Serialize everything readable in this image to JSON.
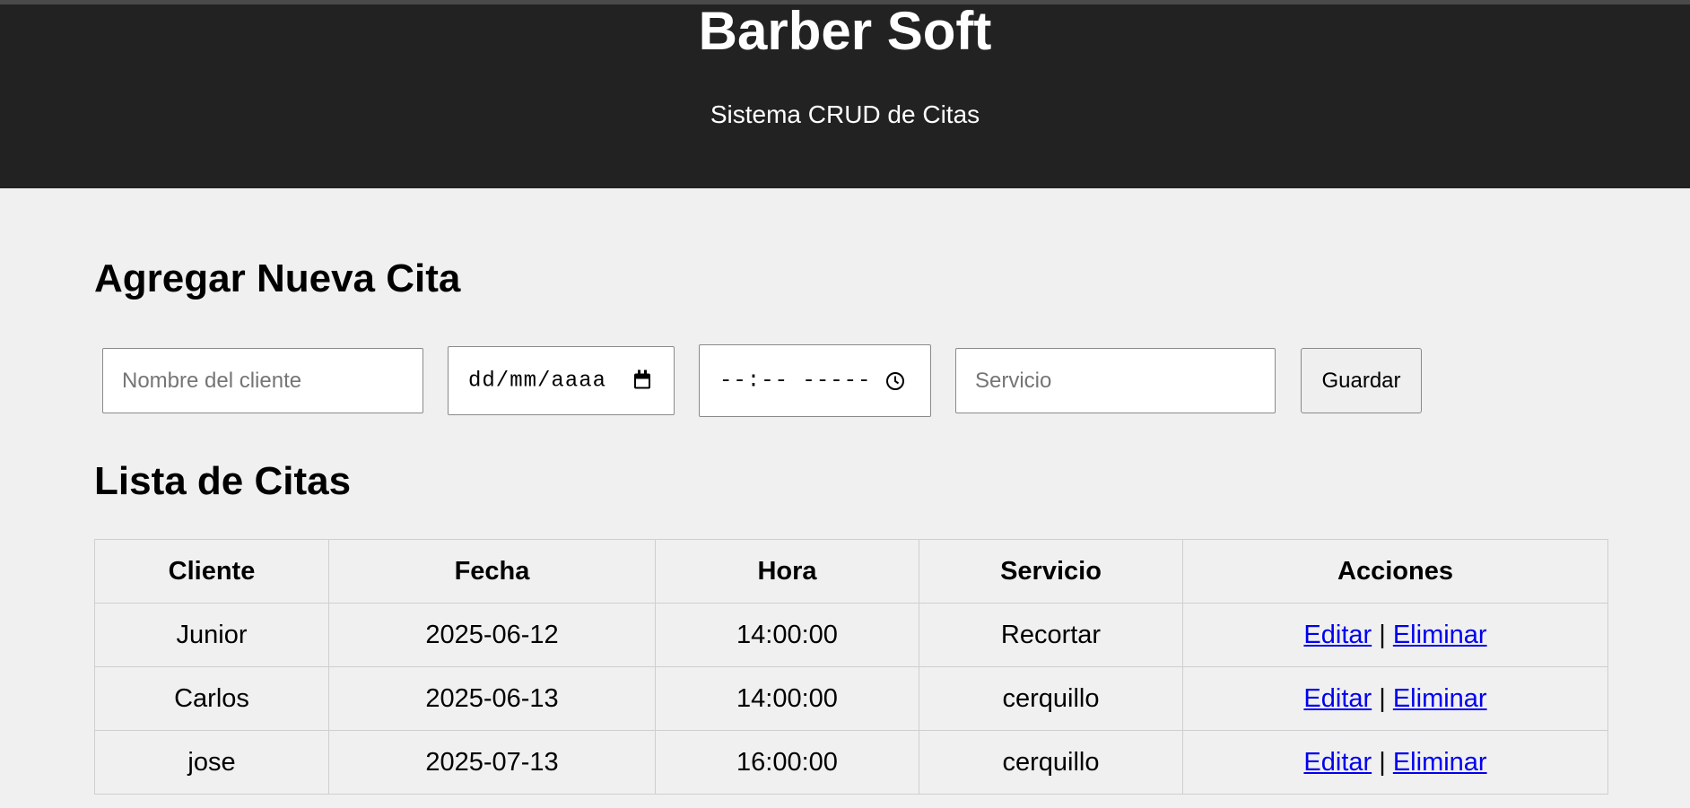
{
  "header": {
    "title": "Barber Soft",
    "subtitle": "Sistema CRUD de Citas"
  },
  "form": {
    "title": "Agregar Nueva Cita",
    "client_placeholder": "Nombre del cliente",
    "date_placeholder": "dd/mm/aaaa",
    "time_placeholder": "--:-- -----",
    "service_placeholder": "Servicio",
    "save_label": "Guardar"
  },
  "list": {
    "title": "Lista de Citas",
    "columns": [
      "Cliente",
      "Fecha",
      "Hora",
      "Servicio",
      "Acciones"
    ],
    "rows": [
      {
        "cliente": "Junior",
        "fecha": "2025-06-12",
        "hora": "14:00:00",
        "servicio": "Recortar",
        "edit": "Editar",
        "sep": "|",
        "delete": "Eliminar"
      },
      {
        "cliente": "Carlos",
        "fecha": "2025-06-13",
        "hora": "14:00:00",
        "servicio": "cerquillo",
        "edit": "Editar",
        "sep": "|",
        "delete": "Eliminar"
      },
      {
        "cliente": "jose",
        "fecha": "2025-07-13",
        "hora": "16:00:00",
        "servicio": "cerquillo",
        "edit": "Editar",
        "sep": "|",
        "delete": "Eliminar"
      }
    ]
  },
  "colors": {
    "header_bg": "#222222",
    "page_bg": "#f0f0f0",
    "link": "#0000ee"
  }
}
